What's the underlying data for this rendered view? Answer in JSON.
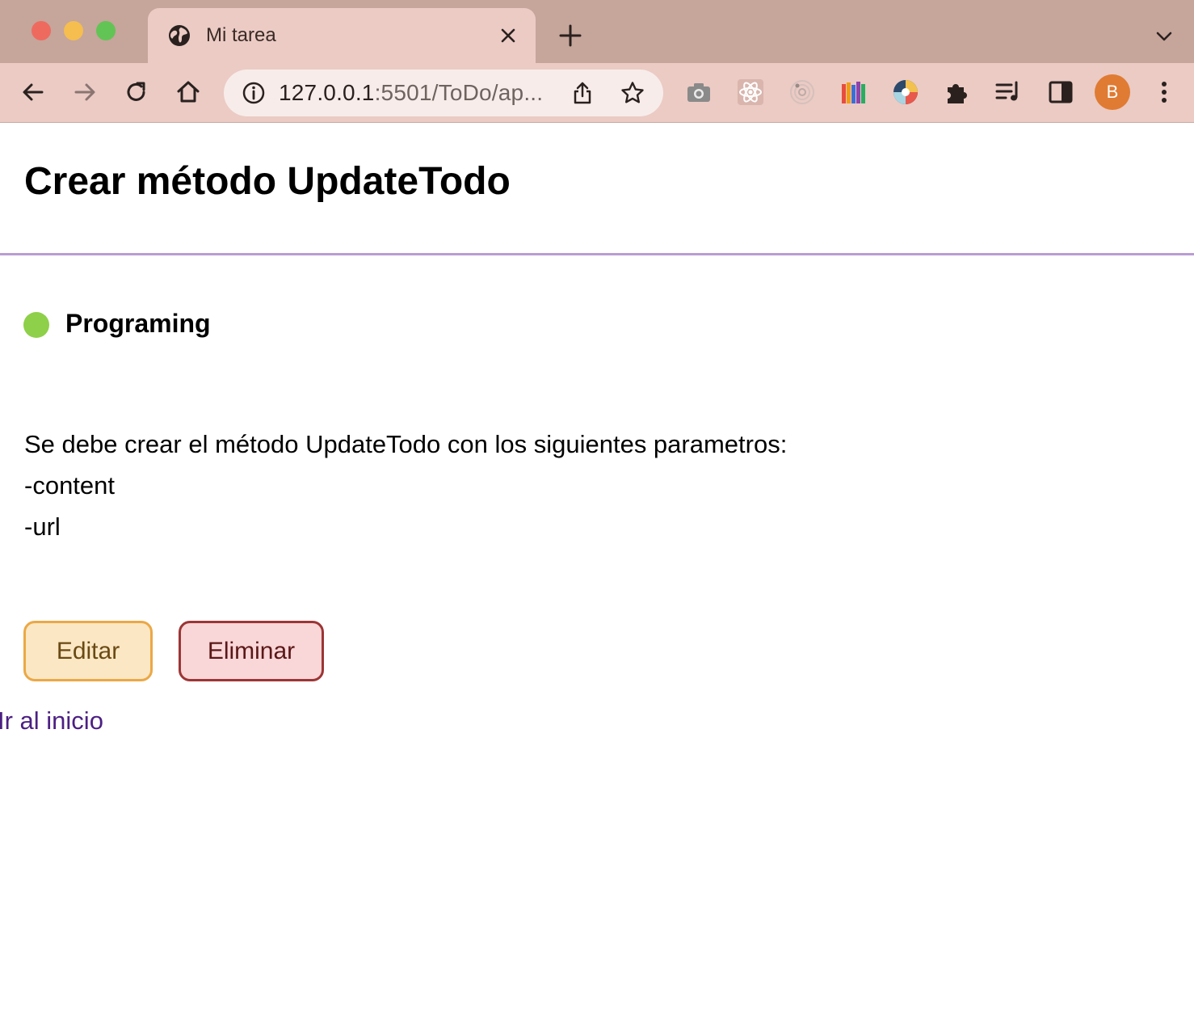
{
  "browser": {
    "tab": {
      "title": "Mi tarea",
      "icon": "globe-icon"
    },
    "omnibox": {
      "url_host": "127.0.0.1",
      "url_rest": ":5501/ToDo/ap..."
    },
    "extensions": [
      "camera-icon",
      "react-devtools-icon",
      "radar-icon",
      "color-pencils-icon",
      "color-wheel-icon",
      "puzzle-icon"
    ],
    "profile_initial": "B",
    "colors": {
      "tabbar": "#c6a59b",
      "toolbar": "#ebcbc4",
      "avatar": "#e07b33"
    }
  },
  "page": {
    "title": "Crear método UpdateTodo",
    "category": "Programing",
    "status_color": "#8ed049",
    "description": {
      "line1": "Se debe crear el método UpdateTodo con los siguientes parametros:",
      "line2": "-content",
      "line3": "-url"
    },
    "actions": {
      "edit_label": "Editar",
      "delete_label": "Eliminar"
    },
    "home_link": "Ir al inicio",
    "divider_color": "#b99cd4"
  }
}
